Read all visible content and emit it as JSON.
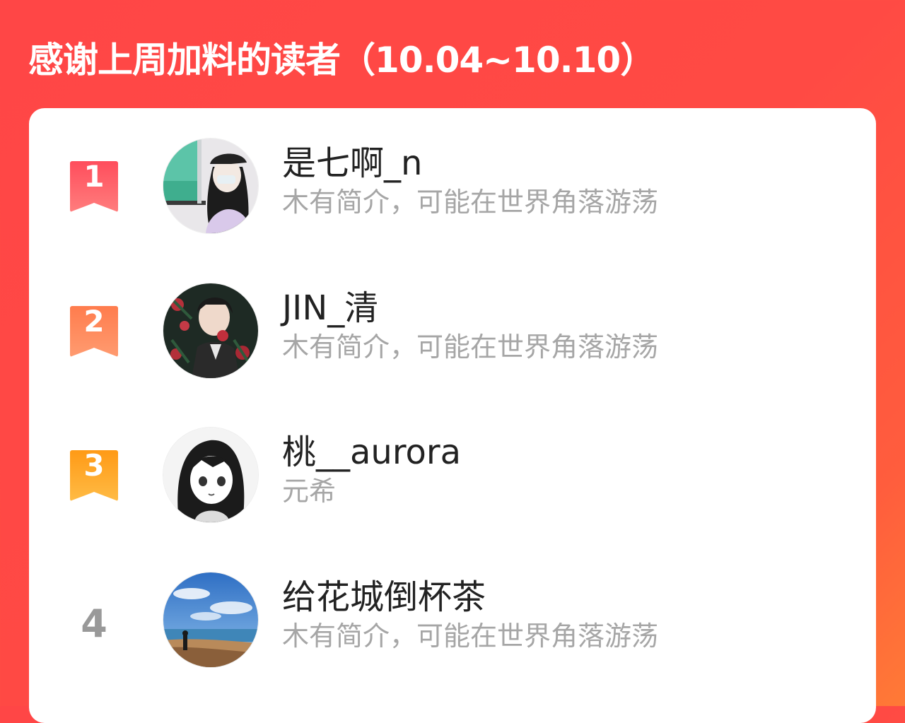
{
  "header": {
    "title": "感谢上周加料的读者（10.04~10.10）"
  },
  "readers": [
    {
      "rank": "1",
      "name": "是七啊_n",
      "bio": "木有简介，可能在世界角落游荡",
      "avatar_icon": "girl-with-cap-avatar"
    },
    {
      "rank": "2",
      "name": "JIN_清",
      "bio": "木有简介，可能在世界角落游荡",
      "avatar_icon": "man-with-roses-avatar"
    },
    {
      "rank": "3",
      "name": "桃__aurora",
      "bio": "元希",
      "avatar_icon": "manga-girl-avatar"
    },
    {
      "rank": "4",
      "name": "给花城倒杯茶",
      "bio": "木有简介，可能在世界角落游荡",
      "avatar_icon": "beach-sky-avatar"
    }
  ],
  "colors": {
    "background": "#ff4a44",
    "rank_1": "#ff5c67",
    "rank_2": "#ff8a5d",
    "rank_3": "#ffa82b",
    "rank_plain": "#999999",
    "name_text": "#222222",
    "bio_text": "#a6a6a6"
  }
}
